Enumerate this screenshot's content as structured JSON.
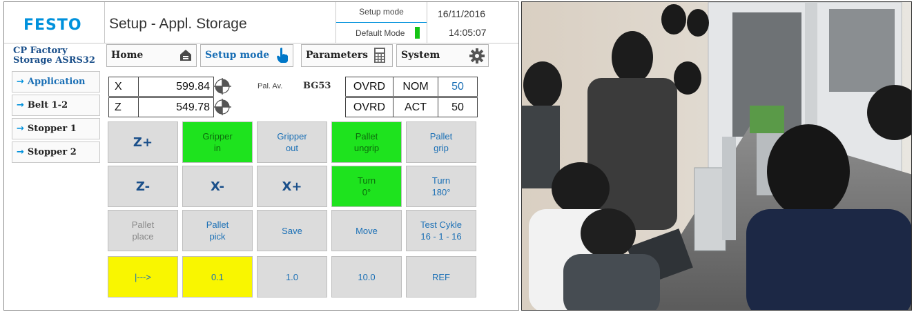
{
  "header": {
    "logo": "FESTO",
    "title": "Setup - Appl. Storage",
    "mode_label": "Setup mode",
    "mode_value": "Default Mode",
    "date": "16/11/2016",
    "time": "14:05:07"
  },
  "station": {
    "line1": "CP Factory",
    "line2": "Storage ASRS32"
  },
  "tabs": [
    {
      "label": "Home",
      "icon": "home-icon"
    },
    {
      "label": "Setup mode",
      "icon": "hand-pointer-icon"
    },
    {
      "label": "Parameters",
      "icon": "calculator-icon"
    },
    {
      "label": "System",
      "icon": "gear-icon"
    }
  ],
  "sidebar": [
    {
      "label": "Application"
    },
    {
      "label": "Belt 1-2"
    },
    {
      "label": "Stopper 1"
    },
    {
      "label": "Stopper 2"
    }
  ],
  "position": {
    "x_label": "X",
    "x_value": "599.84",
    "z_label": "Z",
    "z_value": "549.78",
    "pal_av": "Pal. Av.",
    "pal_av_value": "BG53"
  },
  "override": {
    "row1": {
      "label": "OVRD",
      "type": "NOM",
      "value": "50"
    },
    "row2": {
      "label": "OVRD",
      "type": "ACT",
      "value": "50"
    }
  },
  "buttons": [
    [
      "Z+",
      "Gripper\nin",
      "Gripper\nout",
      "Pallet\nungrip",
      "Pallet\ngrip"
    ],
    [
      "Z-",
      "X-",
      "X+",
      "Turn\n0°",
      "Turn\n180°"
    ],
    [
      "Pallet\nplace",
      "Pallet\npick",
      "Save",
      "Move",
      "Test Cykle\n16 - 1 - 16"
    ],
    [
      "|--->",
      "0.1",
      "1.0",
      "10.0",
      "REF"
    ]
  ],
  "colors": {
    "brand": "#0091dc",
    "active_green": "#1ee31e",
    "step_yellow": "#f9f600",
    "button_gray": "#dcdcdc",
    "text_blue": "#1a6fb5"
  }
}
